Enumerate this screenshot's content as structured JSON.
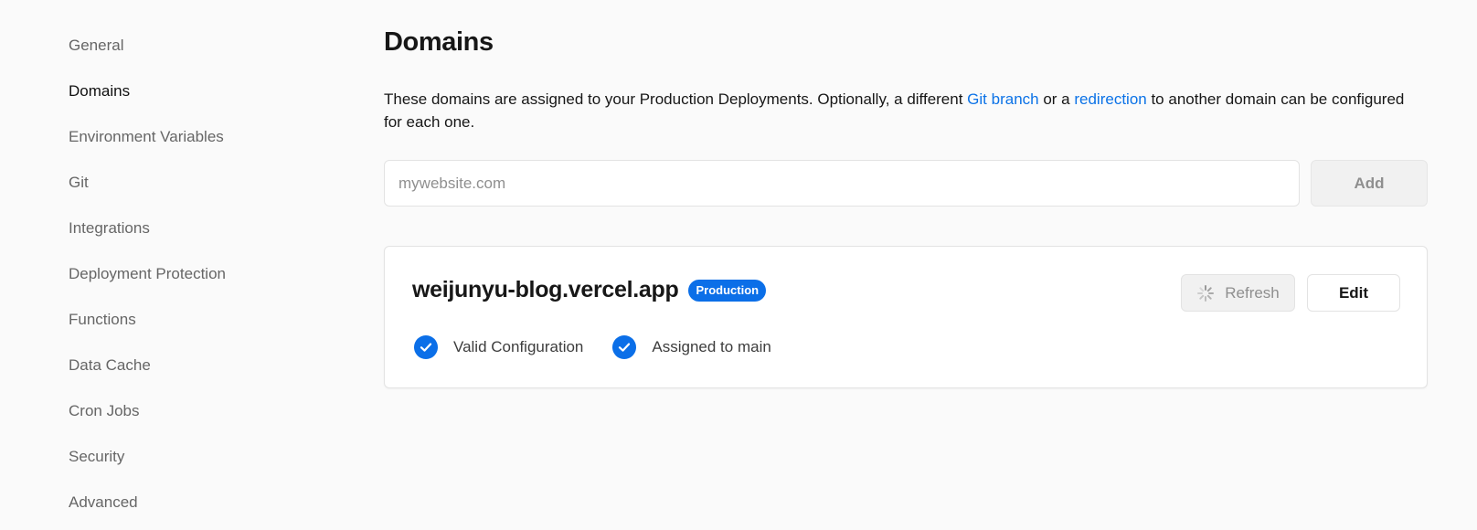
{
  "sidebar": {
    "items": [
      {
        "label": "General"
      },
      {
        "label": "Domains"
      },
      {
        "label": "Environment Variables"
      },
      {
        "label": "Git"
      },
      {
        "label": "Integrations"
      },
      {
        "label": "Deployment Protection"
      },
      {
        "label": "Functions"
      },
      {
        "label": "Data Cache"
      },
      {
        "label": "Cron Jobs"
      },
      {
        "label": "Security"
      },
      {
        "label": "Advanced"
      }
    ],
    "active": "Domains"
  },
  "main": {
    "title": "Domains",
    "description": {
      "part1": "These domains are assigned to your Production Deployments. Optionally, a different ",
      "link1": "Git branch",
      "part2": " or a ",
      "link2": "redirection",
      "part3": " to another domain can be configured for each one."
    },
    "add": {
      "placeholder": "mywebsite.com",
      "value": "",
      "button_label": "Add"
    },
    "domain_card": {
      "name": "weijunyu-blog.vercel.app",
      "badge": "Production",
      "refresh_label": "Refresh",
      "edit_label": "Edit",
      "statuses": [
        {
          "label": "Valid Configuration",
          "icon": "check-circle-icon"
        },
        {
          "label": "Assigned to main",
          "icon": "check-circle-icon"
        }
      ]
    }
  },
  "colors": {
    "accent": "#0b6fe8",
    "link": "#0b72e7",
    "background": "#fafafa"
  }
}
